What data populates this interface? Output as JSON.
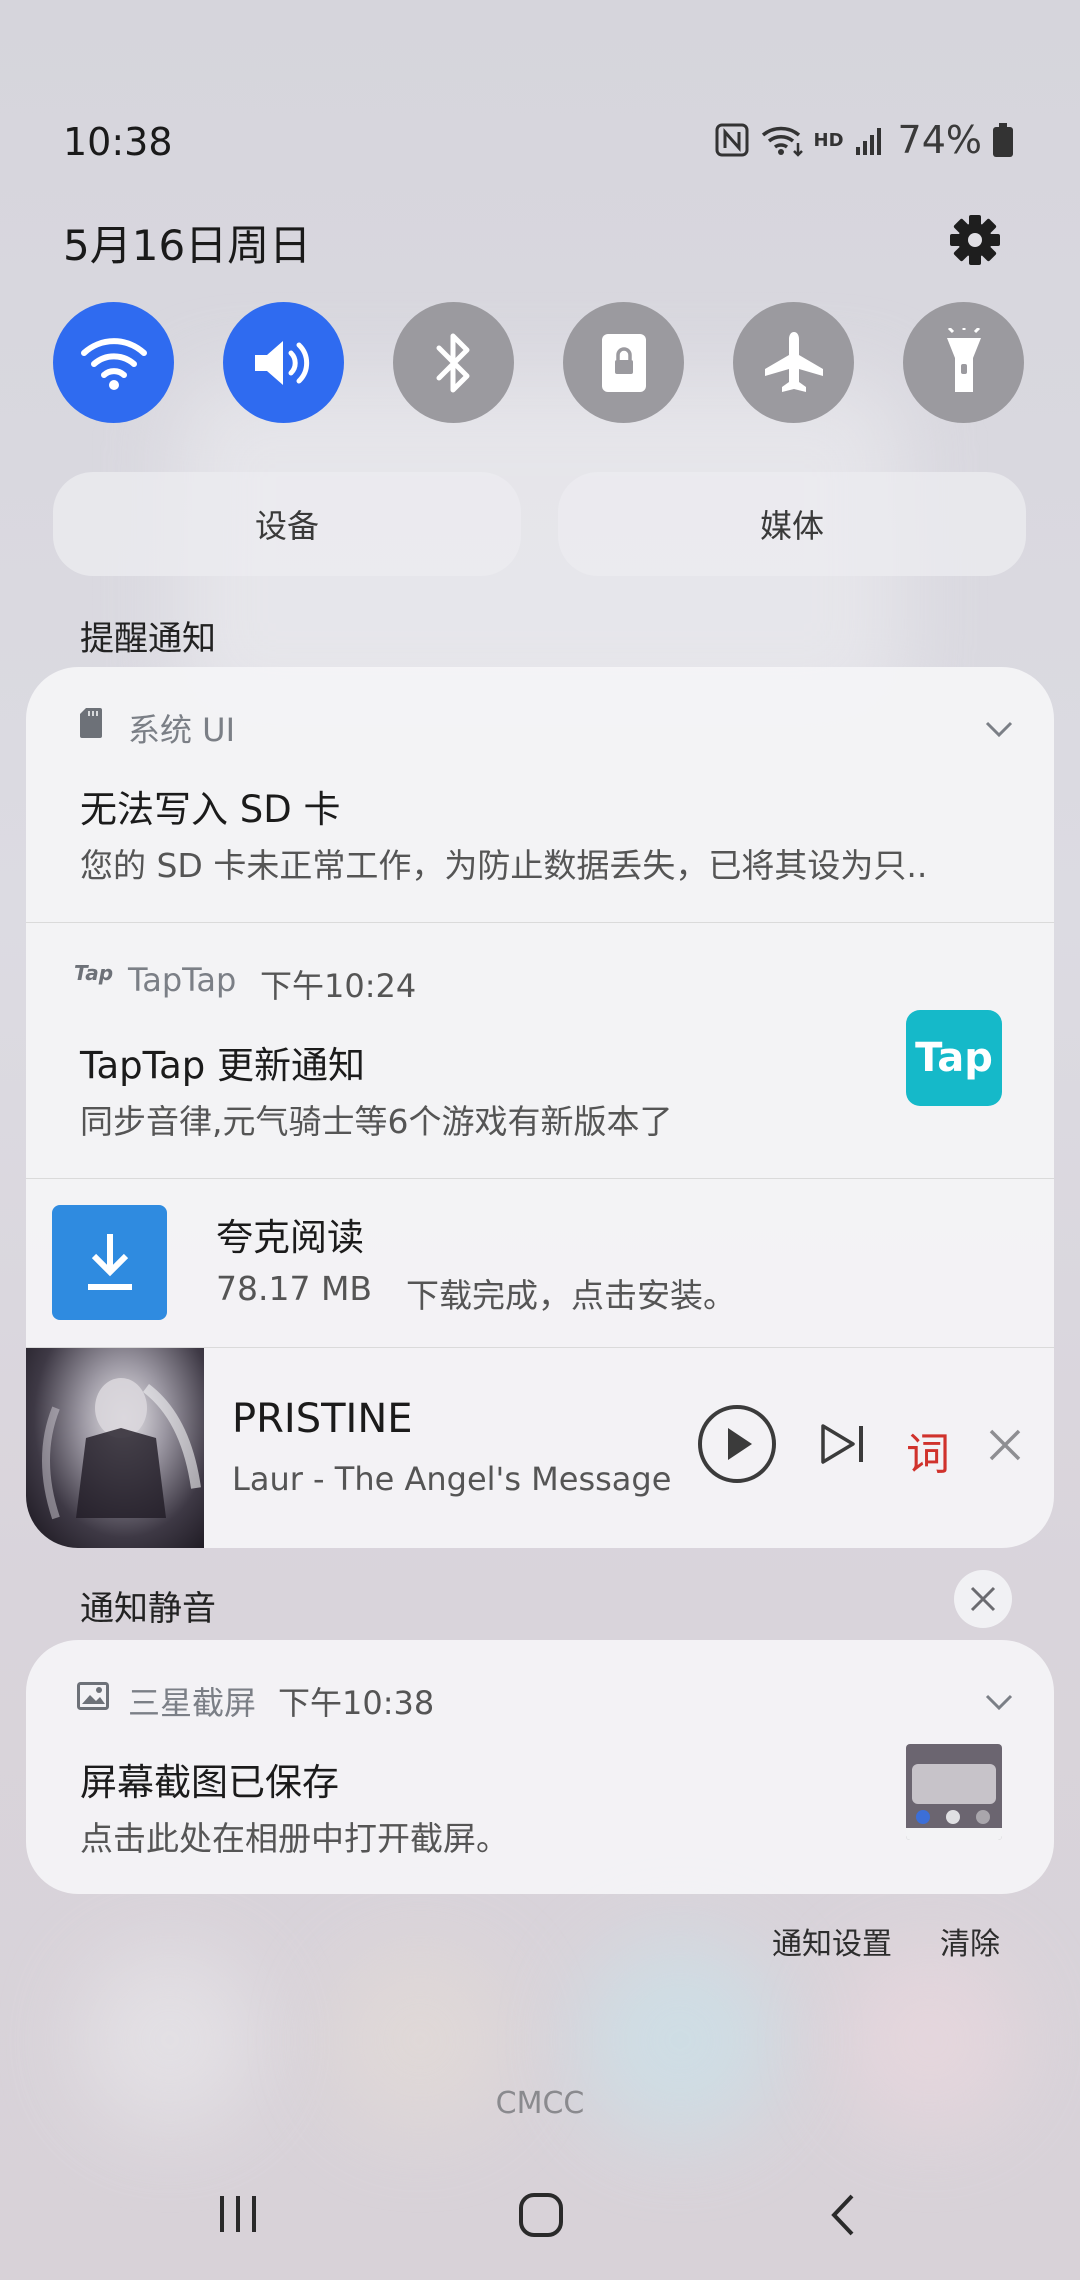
{
  "status_bar": {
    "time": "10:38",
    "battery": "74%"
  },
  "date": "5月16日周日",
  "quick_toggles": [
    {
      "name": "wifi",
      "on": true
    },
    {
      "name": "sound",
      "on": true
    },
    {
      "name": "bluetooth",
      "on": false
    },
    {
      "name": "rotation-lock",
      "on": false
    },
    {
      "name": "airplane-mode",
      "on": false
    },
    {
      "name": "flashlight",
      "on": false
    }
  ],
  "panel_buttons": {
    "devices": "设备",
    "media": "媒体"
  },
  "alert_section": {
    "title": "提醒通知"
  },
  "notifications": {
    "sd_card": {
      "app": "系统 UI",
      "title": "无法写入 SD 卡",
      "body": "您的 SD 卡未正常工作，为防止数据丢失，已将其设为只.."
    },
    "taptap": {
      "app_badge": "Tap",
      "app": "TapTap",
      "time": "下午10:24",
      "title": "TapTap 更新通知",
      "body": "同步音律,元气骑士等6个游戏有新版本了",
      "thumb_label": "Tap"
    },
    "download": {
      "title": "夸克阅读",
      "size": "78.17 MB",
      "body": "下载完成，点击安装。"
    },
    "music": {
      "title": "PRISTINE",
      "subtitle": "Laur - The Angel's Message",
      "lyrics_label": "词"
    }
  },
  "muted_section": {
    "title": "通知静音"
  },
  "screenshot_notification": {
    "app": "三星截屏",
    "time": "下午10:38",
    "title": "屏幕截图已保存",
    "body": "点击此处在相册中打开截屏。"
  },
  "footer": {
    "settings": "通知设置",
    "clear": "清除"
  },
  "carrier": "CMCC",
  "colors": {
    "toggle_on": "#2f6bf0",
    "toggle_off": "#9b9a9f",
    "taptap": "#15b9c9",
    "download_blue": "#2f8be0",
    "lyrics_red": "#d0322c"
  }
}
